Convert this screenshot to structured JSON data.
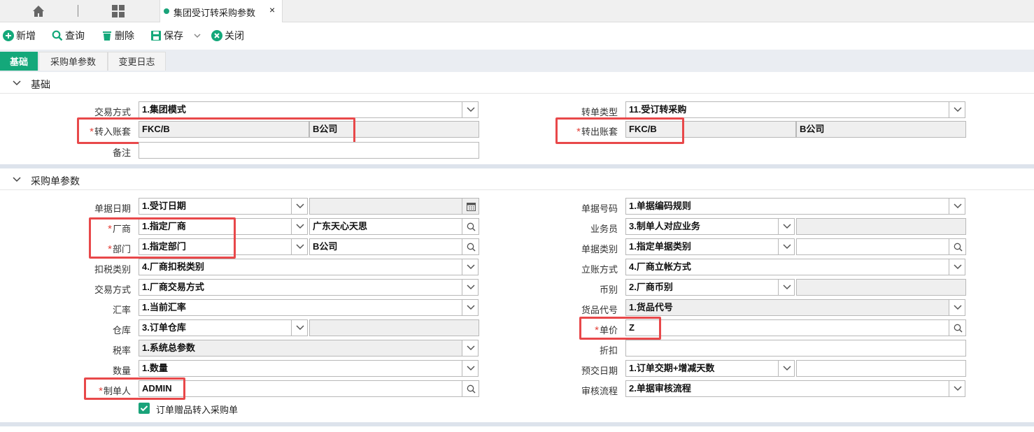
{
  "tab": {
    "title": "集团受订转采购参数",
    "close": "×"
  },
  "toolbar": {
    "new_label": "新增",
    "query_label": "查询",
    "delete_label": "删除",
    "save_label": "保存",
    "close_label": "关闭"
  },
  "subtabs": [
    "基础",
    "采购单参数",
    "变更日志"
  ],
  "sections": {
    "basic": "基础",
    "purchase": "采购单参数"
  },
  "basic": {
    "trade_mode": {
      "label": "交易方式",
      "value": "1.集团模式"
    },
    "transfer_type": {
      "label": "转单类型",
      "value": "11.受订转采购"
    },
    "in_account": {
      "label": "转入账套",
      "code": "FKC/B",
      "name": "B公司"
    },
    "out_account": {
      "label": "转出账套",
      "code": "FKC/B",
      "name": "B公司"
    },
    "remark": {
      "label": "备注",
      "value": ""
    }
  },
  "purchase": {
    "doc_date": {
      "label": "单据日期",
      "value": "1.受订日期",
      "extra": ""
    },
    "doc_number": {
      "label": "单据号码",
      "value": "1.单据编码规则"
    },
    "vendor": {
      "label": "厂商",
      "value": "1.指定厂商",
      "extra": "广东天心天思"
    },
    "salesman": {
      "label": "业务员",
      "value": "3.制单人对应业务",
      "extra": ""
    },
    "dept": {
      "label": "部门",
      "value": "1.指定部门",
      "extra": "B公司"
    },
    "doc_category": {
      "label": "单据类别",
      "value": "1.指定单据类别",
      "extra": ""
    },
    "tax_category": {
      "label": "扣税类别",
      "value": "4.厂商扣税类别"
    },
    "account_mode": {
      "label": "立账方式",
      "value": "4.厂商立帐方式"
    },
    "trade_mode": {
      "label": "交易方式",
      "value": "1.厂商交易方式"
    },
    "currency": {
      "label": "币别",
      "value": "2.厂商币别",
      "extra": ""
    },
    "exchange_rate": {
      "label": "汇率",
      "value": "1.当前汇率"
    },
    "goods_code": {
      "label": "货品代号",
      "value": "1.货品代号"
    },
    "warehouse": {
      "label": "仓库",
      "value": "3.订单仓库",
      "extra": ""
    },
    "unit_price": {
      "label": "单价",
      "value": "Z"
    },
    "tax_rate": {
      "label": "税率",
      "value": "1.系统总参数"
    },
    "discount": {
      "label": "折扣",
      "value": ""
    },
    "quantity": {
      "label": "数量",
      "value": "1.数量"
    },
    "delivery_date": {
      "label": "预交日期",
      "value": "1.订单交期+增减天数",
      "extra": ""
    },
    "creator": {
      "label": "制单人",
      "value": "ADMIN"
    },
    "approval": {
      "label": "审核流程",
      "value": "2.单据审核流程"
    },
    "gift_checkbox": "订单赠品转入采购单"
  },
  "colors": {
    "accent": "#14a87a",
    "required": "#e5423a",
    "highlight": "#e8484a"
  }
}
